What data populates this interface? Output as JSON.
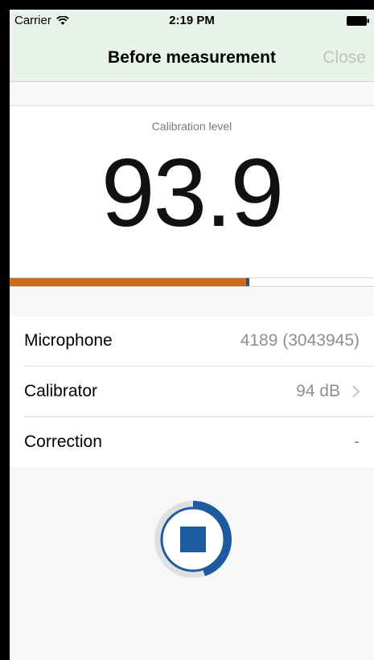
{
  "status_bar": {
    "carrier": "Carrier",
    "time": "2:19 PM"
  },
  "nav": {
    "title": "Before measurement",
    "close_label": "Close"
  },
  "calibration": {
    "label": "Calibration level",
    "value": "93.9",
    "level_fraction": 0.65,
    "level_color": "#c96b24",
    "marker_color": "#3e4f63"
  },
  "info_rows": [
    {
      "label": "Microphone",
      "value": "4189 (3043945)"
    },
    {
      "label": "Calibrator",
      "value": "94 dB"
    },
    {
      "label": "Correction",
      "value": "-"
    }
  ],
  "control": {
    "icon": "stop-icon",
    "progress_fraction": 0.45,
    "accent": "#1e5aa0"
  }
}
